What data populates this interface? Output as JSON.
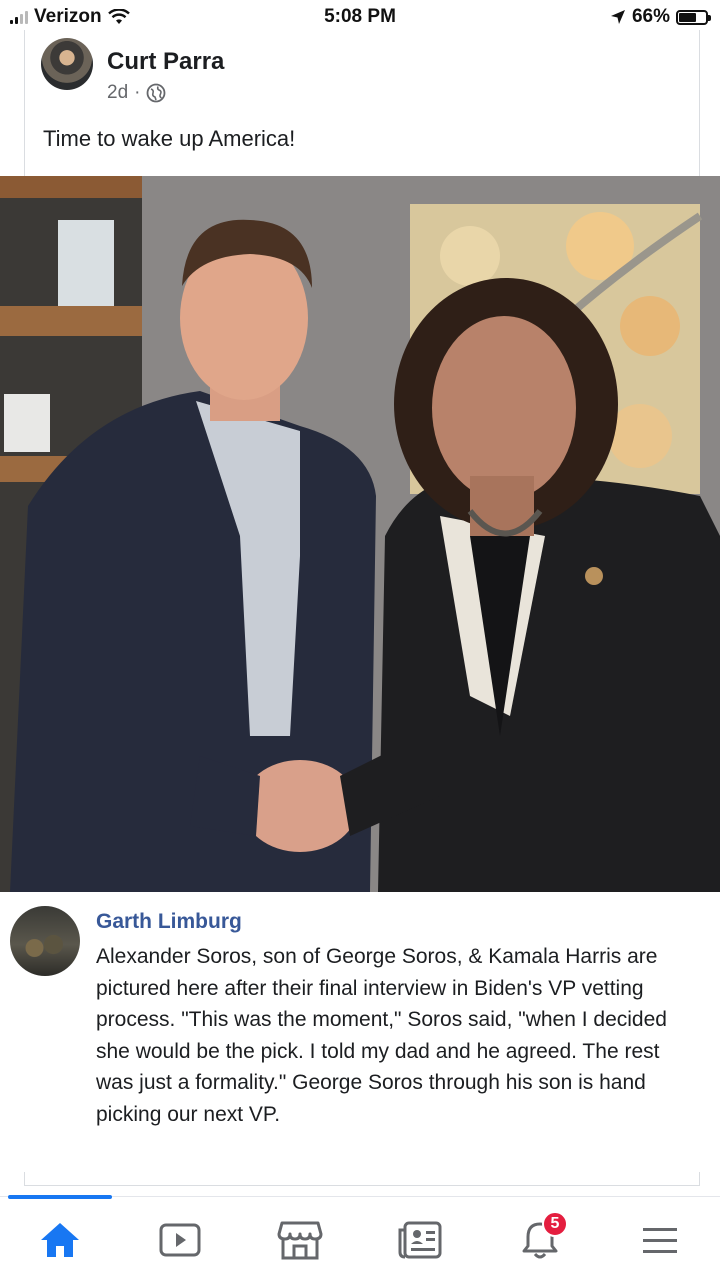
{
  "status_bar": {
    "carrier": "Verizon",
    "time": "5:08 PM",
    "battery": "66%",
    "battery_level": 0.66,
    "icons": [
      "signal-icon",
      "wifi-icon",
      "location-arrow-icon",
      "battery-icon"
    ]
  },
  "post": {
    "author": "Curt Parra",
    "time": "2d",
    "separator": "·",
    "text": "Time to wake up America!",
    "privacy_icon": "globe-icon"
  },
  "comment": {
    "author": "Garth Limburg",
    "text": "Alexander Soros, son of George Soros, & Kamala Harris are pictured here after their final interview in Biden's VP vetting process. \"This was the moment,\" Soros said, \"when I decided she would be the pick. I told my dad and he agreed. The rest was just a formality.\" George Soros through his son is hand picking our next VP."
  },
  "bottom_nav": {
    "items": [
      {
        "icon": "home-icon",
        "active": true
      },
      {
        "icon": "video-icon",
        "active": false
      },
      {
        "icon": "marketplace-icon",
        "active": false
      },
      {
        "icon": "news-icon",
        "active": false
      },
      {
        "icon": "bell-icon",
        "active": false,
        "badge": "5"
      },
      {
        "icon": "menu-icon",
        "active": false
      }
    ]
  },
  "colors": {
    "accent": "#1877f2",
    "link": "#385898",
    "badge": "#e41e3f",
    "icon_gray": "#65676b"
  }
}
